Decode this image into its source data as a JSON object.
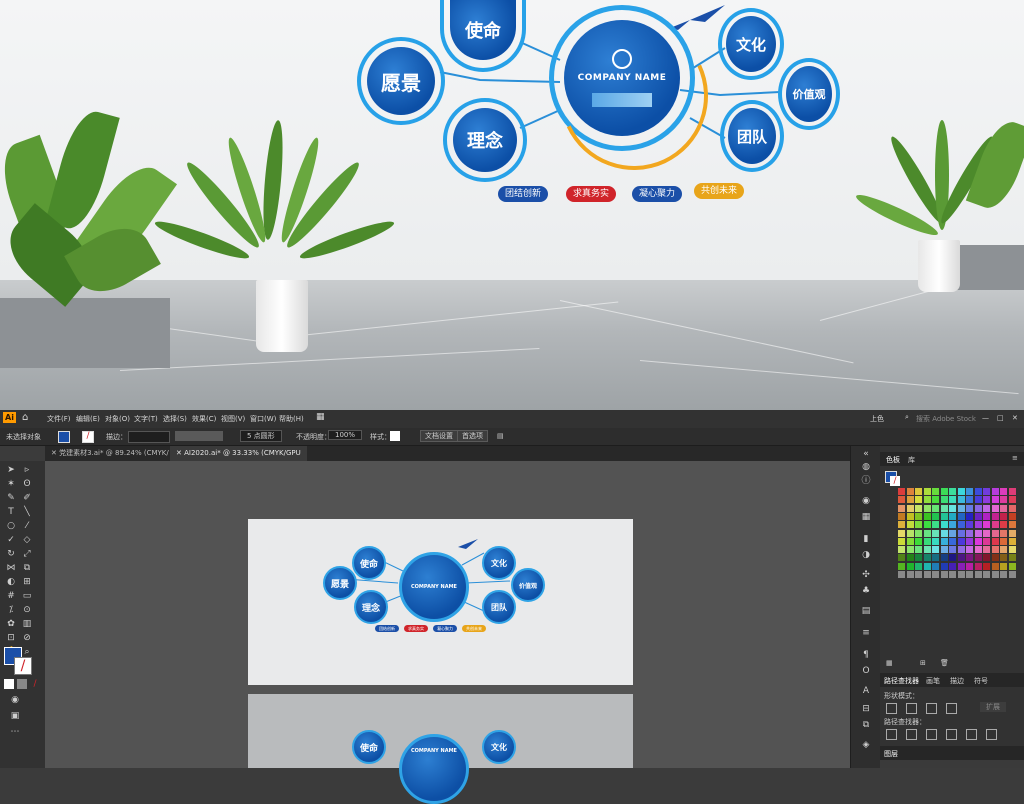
{
  "photo": {
    "logo": "COMPANY NAME",
    "bubbles": {
      "vision": "愿景",
      "mission": "使命",
      "philosophy": "理念",
      "culture": "文化",
      "values": "价值观",
      "team": "团队"
    },
    "tags": [
      {
        "label": "团结创新",
        "color": "#1b4fa8"
      },
      {
        "label": "求真务实",
        "color": "#d0242a"
      },
      {
        "label": "凝心聚力",
        "color": "#1b4fa8"
      },
      {
        "label": "共创未来",
        "color": "#e8a51a"
      }
    ]
  },
  "illustrator": {
    "app_badge": "Ai",
    "menu": [
      "文件(F)",
      "编辑(E)",
      "对象(O)",
      "文字(T)",
      "选择(S)",
      "效果(C)",
      "视图(V)",
      "窗口(W)",
      "帮助(H)"
    ],
    "workspace": "上色",
    "search_placeholder": "搜索 Adobe Stock",
    "control": {
      "selection": "未选择对象",
      "stroke_label": "描边：",
      "brush": "5 点圆形",
      "opacity_label": "不透明度：",
      "opacity_value": "100%",
      "style_label": "样式：",
      "doc_setup": "文档设置",
      "preferences": "首选项"
    },
    "tabs": [
      {
        "label": "党建素材3.ai* @ 89.24% (CMYK/预览)",
        "active": false
      },
      {
        "label": "AI2020.ai* @ 33.33% (CMYK/GPU 预览)",
        "active": true
      }
    ],
    "artboard": {
      "logo": "COMPANY NAME",
      "bubbles": {
        "vision": "愿景",
        "mission": "使命",
        "philosophy": "理念",
        "culture": "文化",
        "values": "价值观",
        "team": "团队"
      },
      "tags": [
        {
          "label": "团结创新",
          "color": "#1b4fa8"
        },
        {
          "label": "求真务实",
          "color": "#d0242a"
        },
        {
          "label": "凝心聚力",
          "color": "#1b4fa8"
        },
        {
          "label": "共创未来",
          "color": "#e8a51a"
        }
      ]
    },
    "panels": {
      "swatches_tab": "色板",
      "library_tab": "库",
      "pathfinder_tabs": [
        "路径查找器",
        "画笔",
        "描边",
        "符号"
      ],
      "shape_modes": "形状模式：",
      "expand": "扩展",
      "pathfinders": "路径查找器：",
      "layers_tab": "图层"
    }
  }
}
